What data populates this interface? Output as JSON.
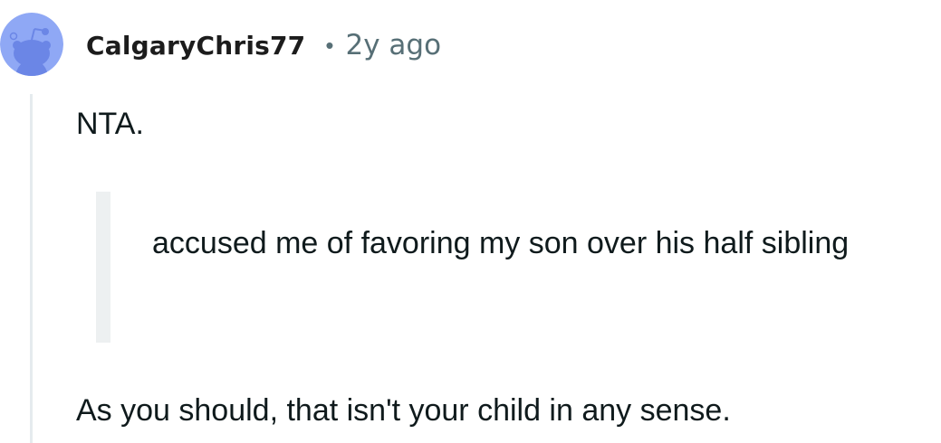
{
  "comment": {
    "avatar_icon": "snoo-avatar-icon",
    "avatar_bg": "#8fa8f5",
    "username": "CalgaryChris77",
    "separator": "•",
    "time": "2y ago",
    "paragraphs": {
      "first": "NTA.",
      "quote": "accused me of favoring my son over his half sibling",
      "last": "As you should, that isn't your child in any sense."
    }
  }
}
